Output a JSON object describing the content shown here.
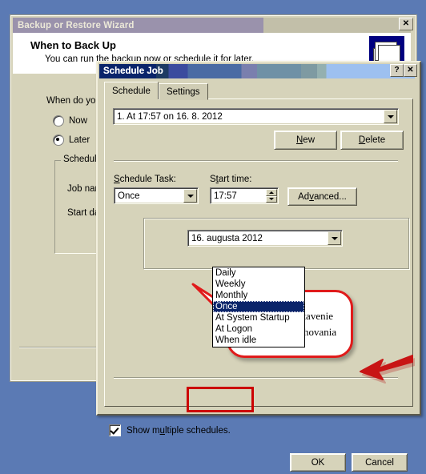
{
  "wizard": {
    "title": "Backup or Restore Wizard",
    "close_label": "✕",
    "heading": "When to Back Up",
    "subheading": "You can run the backup now or schedule it for later.",
    "prompt": "When do you",
    "radios": [
      {
        "label": "Now",
        "selected": false
      },
      {
        "label": "Later",
        "selected": true
      }
    ],
    "group_label": "Schedule e",
    "fields": [
      {
        "label": "Job name:"
      },
      {
        "label": "Start date:"
      }
    ]
  },
  "dialog": {
    "title": "Schedule Job",
    "help_label": "?",
    "close_label": "✕",
    "tabs": [
      {
        "label": "Schedule",
        "active": true
      },
      {
        "label": "Settings",
        "active": false
      }
    ],
    "schedule_combo": {
      "value": "1. At 17:57 on 16. 8. 2012"
    },
    "new_button": {
      "prefix": "",
      "accel": "N",
      "suffix": "ew"
    },
    "delete_button": {
      "prefix": "",
      "accel": "D",
      "suffix": "elete"
    },
    "schedule_task": {
      "label_prefix": "",
      "label_accel": "S",
      "label_suffix": "chedule Task:",
      "value": "Once",
      "options": [
        "Daily",
        "Weekly",
        "Monthly",
        "Once",
        "At System Startup",
        "At Logon",
        "When idle"
      ],
      "selected_option": "Once"
    },
    "start_time": {
      "label_prefix": "S",
      "label_accel": "t",
      "label_suffix": "art time:",
      "value": "17:57"
    },
    "advanced_button": {
      "prefix": "Ad",
      "accel": "v",
      "suffix": "anced..."
    },
    "date_picker": {
      "value": "16.   augusta   2012"
    },
    "show_multiple": {
      "label_prefix": "Show m",
      "label_accel": "u",
      "label_suffix": "ltiple schedules.",
      "checked": true
    },
    "ok_button": "OK",
    "cancel_button": "Cancel"
  },
  "annotation": {
    "callout_line1": "Pokročilé nastavenie",
    "callout_line2": "spúšťania zálohovania",
    "accent_color": "#cc0000",
    "bubble_border_color": "#e01b1b"
  }
}
